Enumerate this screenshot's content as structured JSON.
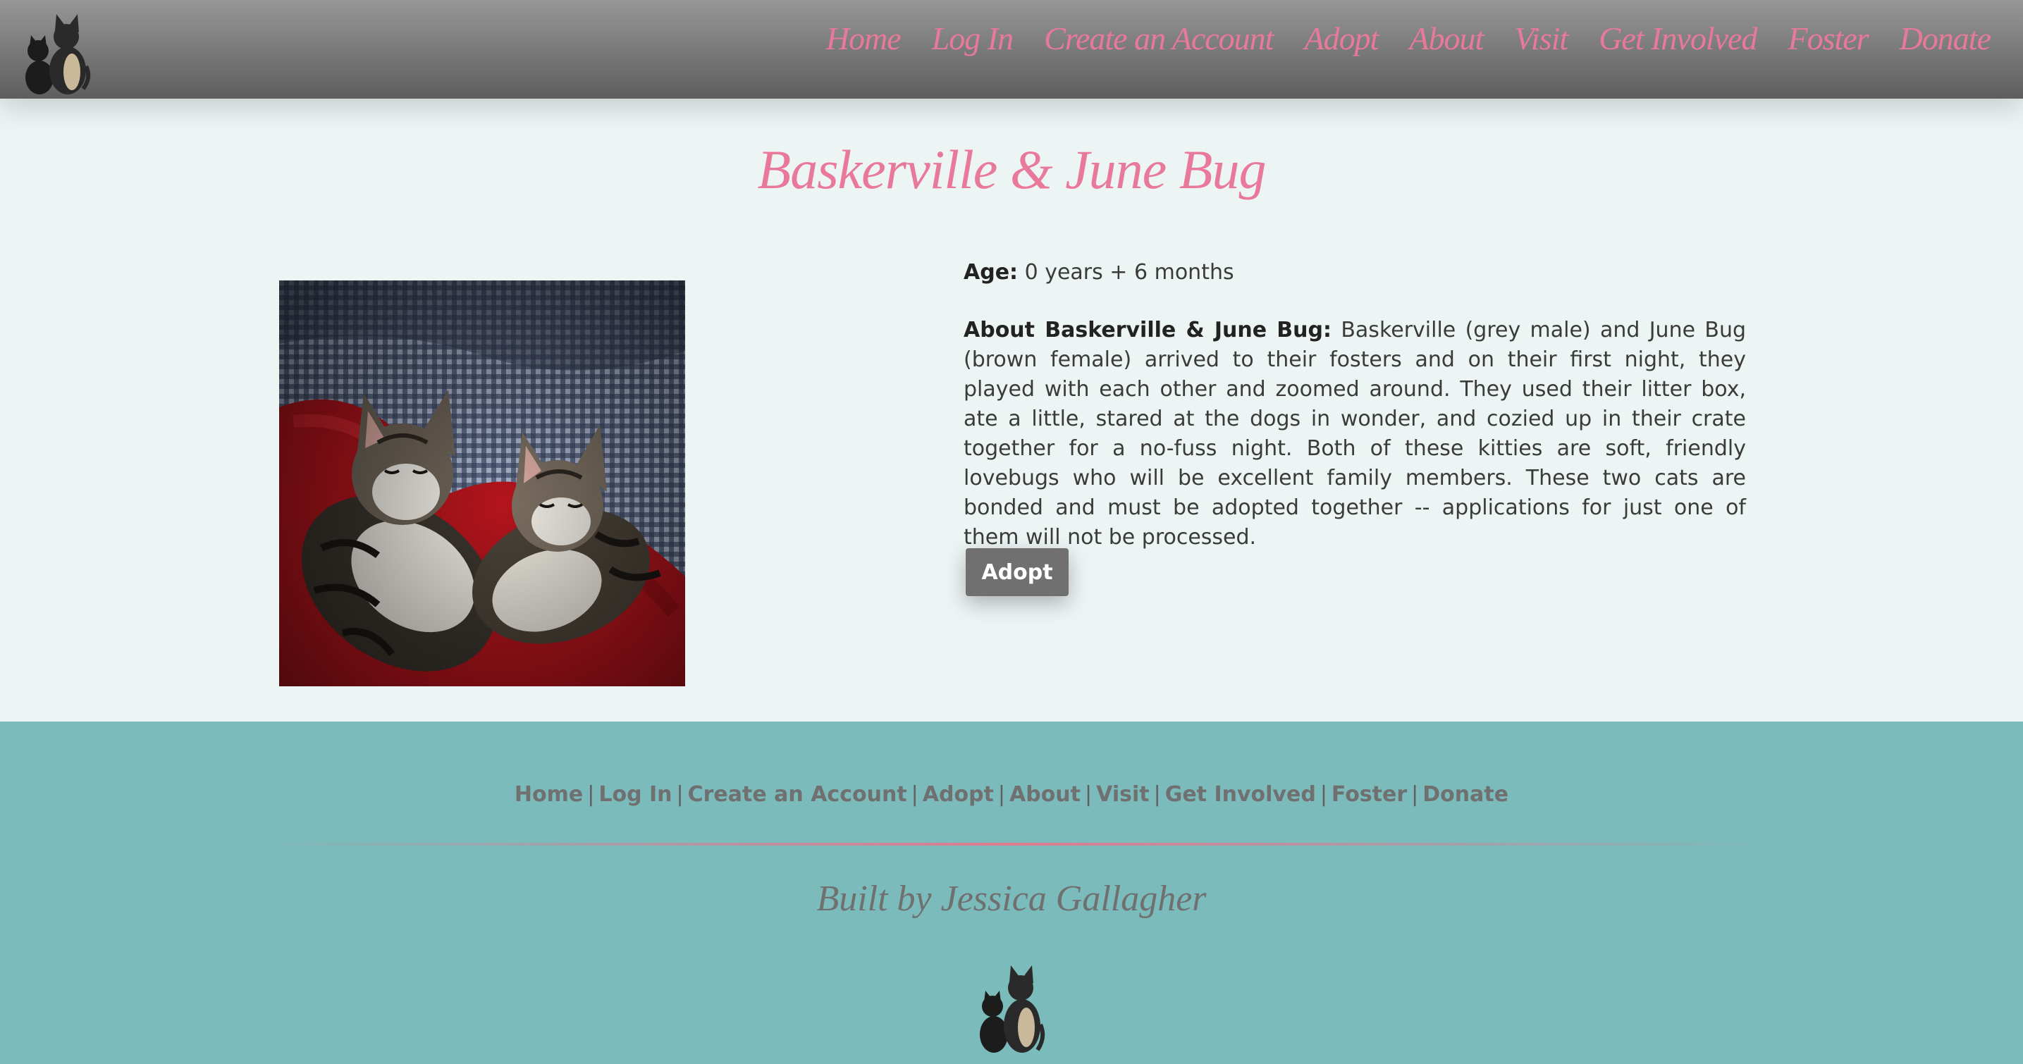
{
  "header": {
    "nav": [
      "Home",
      "Log In",
      "Create an Account",
      "Adopt",
      "About",
      "Visit",
      "Get Involved",
      "Foster",
      "Donate"
    ]
  },
  "pet": {
    "name": "Baskerville & June Bug",
    "age_label": "Age:",
    "age_value": "0 years + 6 months",
    "about_label": "About Baskerville & June Bug:",
    "about_text": "Baskerville (grey male) and June Bug (brown female) arrived to their fosters and on their first night, they played with each other and zoomed around. They used their litter box, ate a little, stared at the dogs in wonder, and cozied up in their crate together for a no-fuss night. Both of these kitties are soft, friendly lovebugs who will be excellent family members. These two cats are bonded and must be adopted together -- applications for just one of them will not be processed.",
    "adopt_button": "Adopt"
  },
  "footer": {
    "links": [
      "Home",
      "Log In",
      "Create an Account",
      "Adopt",
      "About",
      "Visit",
      "Get Involved",
      "Foster",
      "Donate"
    ],
    "separator": "|",
    "credit": "Built by Jessica Gallagher"
  },
  "icons": {
    "logo": "two-cats-silhouette-icon"
  },
  "colors": {
    "accent_pink": "#e9799a",
    "footer_teal": "#7bbbbb",
    "button_grey": "#707070",
    "page_bg": "#edf4f4"
  }
}
